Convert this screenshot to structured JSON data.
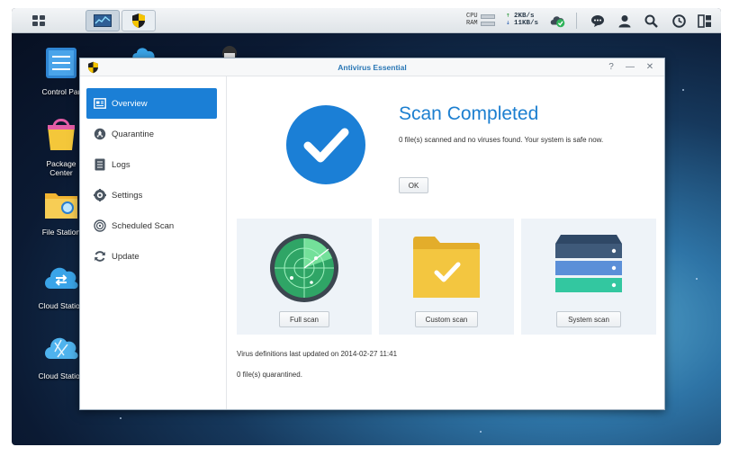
{
  "desktop": {
    "icons": [
      {
        "label": "Control Par"
      },
      {
        "label": "Package\nCenter"
      },
      {
        "label": "File Station"
      },
      {
        "label": "Cloud Station"
      },
      {
        "label": "Cloud Station"
      }
    ]
  },
  "taskbar": {
    "cpu_label": "CPU",
    "ram_label": "RAM",
    "upload": "2KB/s",
    "download": "11KB/s",
    "icons": [
      "main-menu-icon",
      "resource-monitor-icon",
      "antivirus-icon",
      "cloud-sync-icon",
      "chat-icon",
      "user-icon",
      "search-icon",
      "widgets-icon",
      "desktop-icon"
    ]
  },
  "window": {
    "title": "Antivirus Essential",
    "help": "?",
    "minimize": "—",
    "close": "✕"
  },
  "sidebar": {
    "items": [
      {
        "label": "Overview",
        "icon": "overview-icon",
        "active": true
      },
      {
        "label": "Quarantine",
        "icon": "quarantine-icon",
        "active": false
      },
      {
        "label": "Logs",
        "icon": "logs-icon",
        "active": false
      },
      {
        "label": "Settings",
        "icon": "settings-icon",
        "active": false
      },
      {
        "label": "Scheduled Scan",
        "icon": "scheduled-scan-icon",
        "active": false
      },
      {
        "label": "Update",
        "icon": "update-icon",
        "active": false
      }
    ]
  },
  "overview": {
    "status_title": "Scan Completed",
    "status_message": "0 file(s) scanned and no viruses found. Your system is safe now.",
    "ok_label": "OK",
    "scan_cards": [
      {
        "button": "Full scan",
        "icon": "radar-icon"
      },
      {
        "button": "Custom scan",
        "icon": "folder-check-icon"
      },
      {
        "button": "System scan",
        "icon": "server-stack-icon"
      }
    ],
    "definitions_text": "Virus definitions last updated on 2014-02-27 11:41",
    "quarantine_text": "0 file(s) quarantined."
  },
  "colors": {
    "accent": "#1b7fd6",
    "title_blue": "#1c7fd0",
    "check_green": "#2fb35a",
    "folder_yellow": "#f3c640",
    "server_dark": "#3f5a7a",
    "server_mid": "#5b8fd8",
    "server_green": "#33c7a0"
  }
}
